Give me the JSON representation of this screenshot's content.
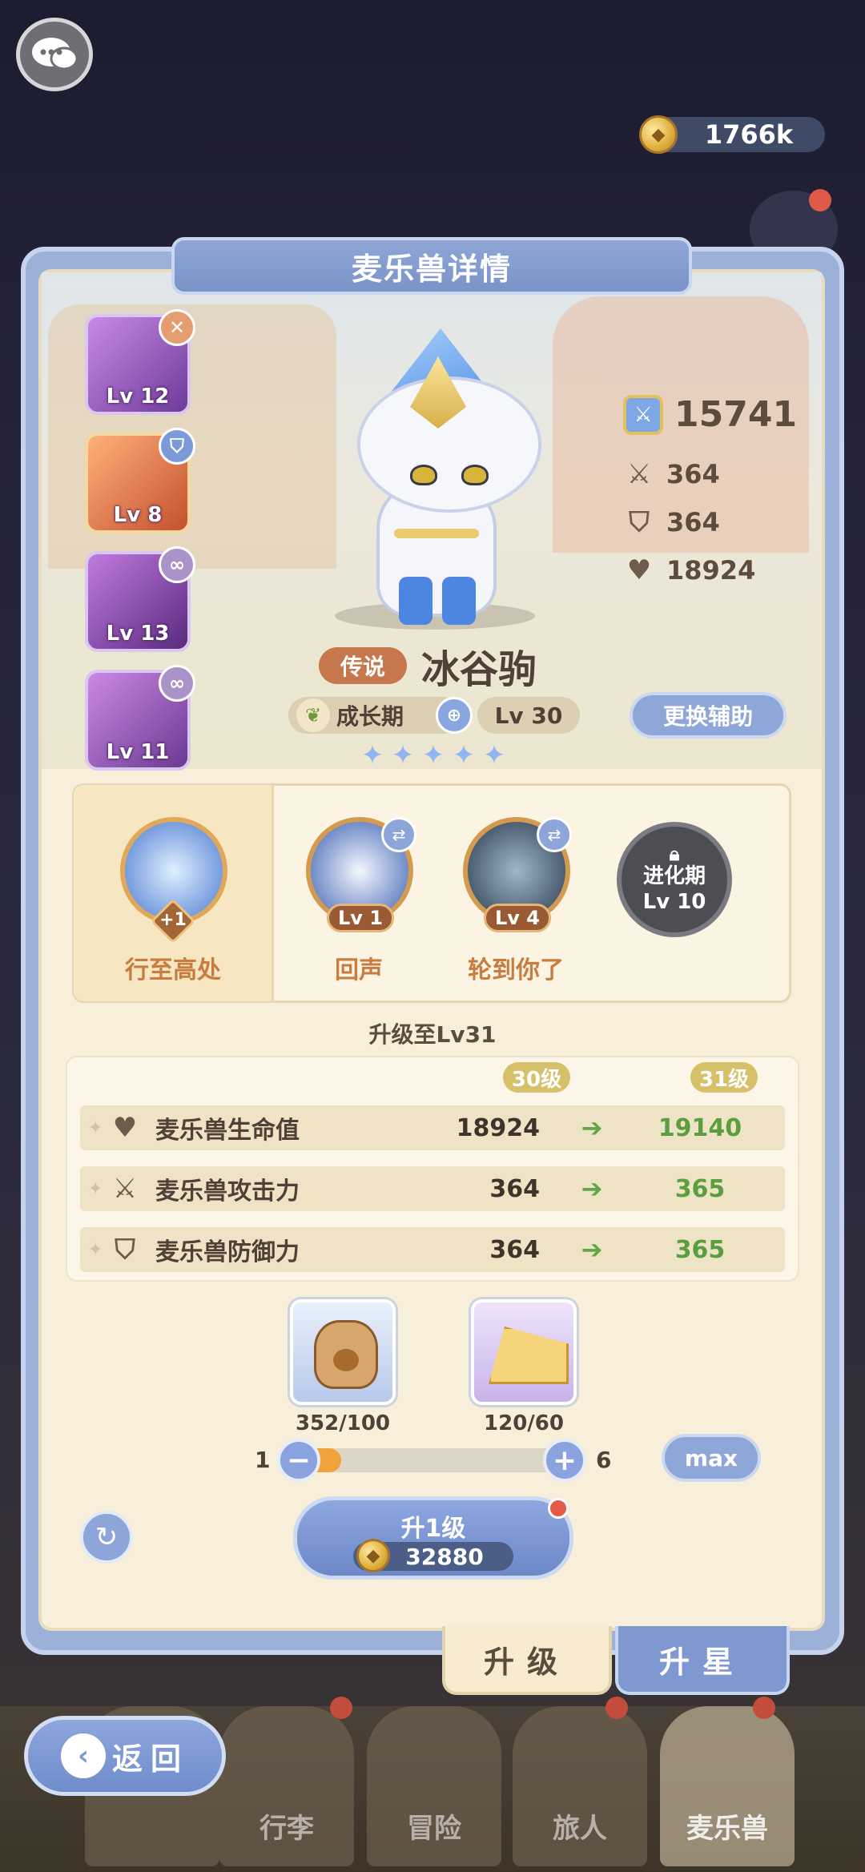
{
  "currency": {
    "amount": "1766k"
  },
  "panel": {
    "title": "麦乐兽详情"
  },
  "companions": [
    {
      "level": "Lv 12",
      "badge": "close-icon",
      "colors": [
        "#b978d9",
        "#6e3a9a"
      ]
    },
    {
      "level": "Lv 8",
      "badge": "shield-icon",
      "colors": [
        "#f39a5e",
        "#c4512e"
      ]
    },
    {
      "level": "Lv 13",
      "badge": "link-icon",
      "colors": [
        "#b36ad2",
        "#5a2a7e"
      ]
    },
    {
      "level": "Lv 11",
      "badge": "link-icon",
      "colors": [
        "#c27bdc",
        "#6a3a92"
      ]
    }
  ],
  "stats": {
    "power": "15741",
    "attack": "364",
    "defense": "364",
    "hp": "18924"
  },
  "pet": {
    "rarity": "传说",
    "name": "冰谷驹",
    "stage": "成长期",
    "level": "Lv 30",
    "stars": 5,
    "swap_label": "更换辅助"
  },
  "skills": [
    {
      "name": "行至高处",
      "badge": "+1"
    },
    {
      "name": "回声",
      "level": "Lv 1"
    },
    {
      "name": "轮到你了",
      "level": "Lv 4"
    },
    {
      "name": "进化期",
      "level": "Lv 10"
    }
  ],
  "upgrade": {
    "title": "升级至Lv31",
    "from_label": "30级",
    "to_label": "31级",
    "rows": [
      {
        "icon": "heart-icon",
        "label": "麦乐兽生命值",
        "current": "18924",
        "next": "19140"
      },
      {
        "icon": "swords-icon",
        "label": "麦乐兽攻击力",
        "current": "364",
        "next": "365"
      },
      {
        "icon": "shield-icon",
        "label": "麦乐兽防御力",
        "current": "364",
        "next": "365"
      }
    ]
  },
  "materials": [
    {
      "name": "food-bag-icon",
      "count": "352/100"
    },
    {
      "name": "cheese-icon",
      "count": "120/60"
    }
  ],
  "slider": {
    "min": "1",
    "max": "6",
    "value": 1,
    "max_label": "max"
  },
  "level_up": {
    "label": "升1级",
    "cost": "32880"
  },
  "tabs": {
    "upgrade": "升级",
    "star": "升星"
  },
  "nav": [
    {
      "label": ""
    },
    {
      "label": "行李"
    },
    {
      "label": "冒险"
    },
    {
      "label": "旅人"
    },
    {
      "label": "麦乐兽"
    }
  ],
  "back_label": "返回"
}
